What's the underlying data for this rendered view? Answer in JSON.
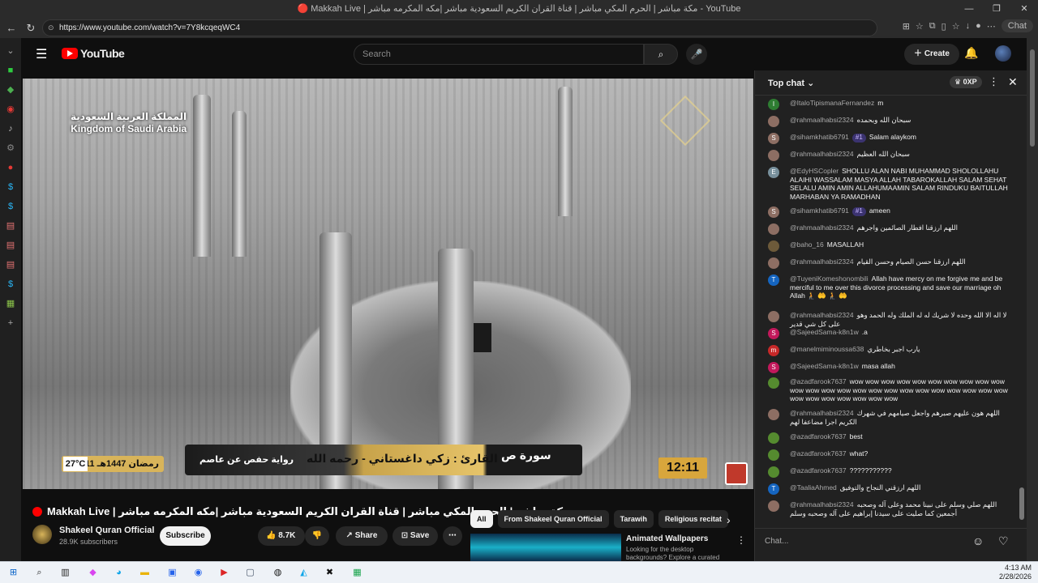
{
  "browser": {
    "window_title": "🔴 Makkah Live | مكة مباشر | الحرم المكي مباشر | قناة القران الكريم السعودية مباشر |مكه المكرمه مباشر - YouTube",
    "url": "https://www.youtube.com/watch?v=7Y8kcqeqWC4",
    "chat_button": "Chat"
  },
  "youtube": {
    "logo": "YouTube",
    "search_placeholder": "Search",
    "create_label": "Create"
  },
  "video": {
    "watermark_ar": "المملكة العربية السعودية",
    "watermark_en": "Kingdom of Saudi Arabia",
    "temperature": "27°C",
    "hijri_date": "11 رمضان 1447هـ",
    "riwaya": "رواية حفص عن عاصم",
    "reciter": "القارئ : زكي داغستاني - رحمه الله",
    "surah": "سورة ص",
    "clock": "12:11",
    "title": "Makkah Live | مكة مباشر | الحرم المكي مباشر | قناة القران الكريم السعودية مباشر |مكه المكرمه مباشر",
    "channel": "Shakeel Quran Official",
    "subscribers": "28.9K subscribers",
    "subscribe_label": "Subscribe",
    "likes": "8.7K",
    "share_label": "Share",
    "save_label": "Save"
  },
  "chips": [
    "All",
    "From Shakeel Quran Official",
    "Tarawih",
    "Religious recitat"
  ],
  "recommendation": {
    "title": "Animated Wallpapers",
    "subtitle": "Looking for the desktop backgrounds? Explore a curated"
  },
  "chat": {
    "header": "Top chat",
    "points": "0XP",
    "input_placeholder": "Chat...",
    "messages": [
      {
        "author": "@ItaloTipismanaFernandez",
        "text": "m",
        "initial": "I",
        "color": "#2e7d32"
      },
      {
        "author": "@rahmaalhabsi2324",
        "text": "سبحان الله وبحمده",
        "initial": "",
        "color": "#8d6e63"
      },
      {
        "author": "@sihamkhatib6791",
        "badge": "#1",
        "text": "Salam alaykom",
        "initial": "S",
        "color": "#8d6e63"
      },
      {
        "author": "@rahmaalhabsi2324",
        "text": "سبحان الله العظيم",
        "initial": "",
        "color": "#8d6e63"
      },
      {
        "author": "@EdyHSCopler",
        "text": "SHOLLU ALAN NABI MUHAMMAD SHOLOLLAHU ALAIHI WASSALAM MASYA ALLAH TABAROKALLAH SALAM SEHAT SELALU AMIN AMIN ALLAHUMAAMIN SALAM RINDUKU BAITULLAH MARHABAN YA RAMADHAN",
        "initial": "E",
        "color": "#78909c"
      },
      {
        "author": "@sihamkhatib6791",
        "badge": "#1",
        "text": "ameen",
        "initial": "S",
        "color": "#8d6e63"
      },
      {
        "author": "@rahmaalhabsi2324",
        "text": "اللهم ارزقنا افطار الصائمين واجرهم",
        "initial": "",
        "color": "#8d6e63"
      },
      {
        "author": "@baho_16",
        "text": "MASALLAH",
        "initial": "",
        "color": "#6d5a3a"
      },
      {
        "author": "@rahmaalhabsi2324",
        "text": "اللهم ارزقنا حسن الصيام وحسن القيام",
        "initial": "",
        "color": "#8d6e63"
      },
      {
        "author": "@TuyeniKomeshonombili",
        "text": "Allah have mercy on me forgive me and be merciful to me over this divorce processing and save our marriage oh Allah 🧎 🤲 🧎 🤲",
        "initial": "T",
        "color": "#1565c0"
      },
      {
        "author": "@rahmaalhabsi2324",
        "text": "لا اله الا الله وحده لا شريك له له الملك وله الحمد وهو على كل شي قدير",
        "initial": "",
        "color": "#8d6e63"
      },
      {
        "author": "@SajeedSama-k8n1w",
        "text": ".a",
        "initial": "S",
        "color": "#c2185b"
      },
      {
        "author": "@manelmiminoussa638",
        "text": "يارب اجبر بخاطري",
        "initial": "m",
        "color": "#c62828"
      },
      {
        "author": "@SajeedSama-k8n1w",
        "text": "masa allah",
        "initial": "S",
        "color": "#c2185b"
      },
      {
        "author": "@azadfarook7637",
        "text": "wow wow wow wow wow wow wow wow wow wow wow wow wow wow wow wow wow wow wow wow wow wow wow wow wow wow wow wow wow wow wow",
        "initial": "",
        "color": "#558b2f"
      },
      {
        "author": "@rahmaalhabsi2324",
        "text": "اللهم هون عليهم صبرهم واجعل صيامهم في شهرك الكريم اجرا مضاعفا لهم",
        "initial": "",
        "color": "#8d6e63"
      },
      {
        "author": "@azadfarook7637",
        "text": "best",
        "initial": "",
        "color": "#558b2f"
      },
      {
        "author": "@azadfarook7637",
        "text": "what?",
        "initial": "",
        "color": "#558b2f"
      },
      {
        "author": "@azadfarook7637",
        "text": "???????????",
        "initial": "",
        "color": "#558b2f"
      },
      {
        "author": "@TaaliaAhmed",
        "text": "اللهم ارزقني النجاح والتوفيق",
        "initial": "T",
        "color": "#1565c0"
      },
      {
        "author": "@rahmaalhabsi2324",
        "text": "اللهم صلي وسلم على نبينا محمد وعلى آله وصحبه أجمعين كما صليت على سيدنا إبراهيم على آله وصحبه وسلم",
        "initial": "",
        "color": "#8d6e63"
      }
    ]
  },
  "taskbar": {
    "time": "4:13 AM",
    "date": "2/28/2026"
  }
}
